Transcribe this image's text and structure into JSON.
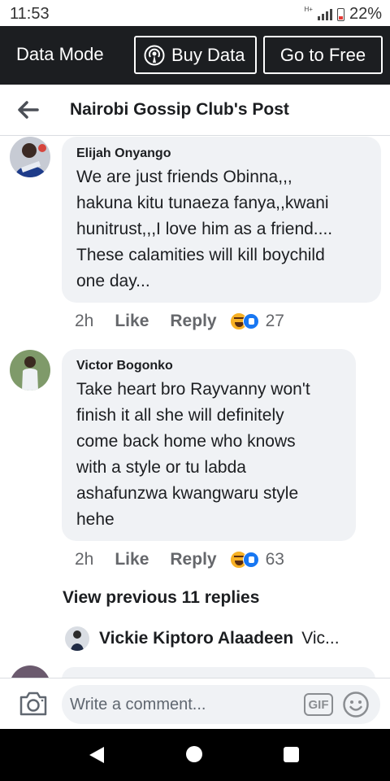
{
  "status_bar": {
    "time": "11:53",
    "network": "H+",
    "battery": "22%"
  },
  "data_banner": {
    "mode_label": "Data Mode",
    "buy_label": "Buy Data",
    "free_label": "Go to Free"
  },
  "header": {
    "title": "Nairobi Gossip Club's Post"
  },
  "comments": [
    {
      "author": "Elijah Onyango",
      "text": "We are just friends Obinna,,,\nhakuna kitu tunaeza fanya,,kwani\nhunitrust,,,I love him as a friend....\nThese calamities will kill boychild\none day...",
      "time": "2h",
      "like": "Like",
      "reply": "Reply",
      "reactions": "27"
    },
    {
      "author": "Victor Bogonko",
      "text": "Take heart bro Rayvanny won't\nfinish it all she will definitely\ncome back home who knows\nwith a style or tu labda\nashafunzwa kwangwaru style\nhehe",
      "time": "2h",
      "like": "Like",
      "reply": "Reply",
      "reactions": "63"
    }
  ],
  "view_previous": "View previous 11 replies",
  "reply_preview": {
    "name": "Vickie Kiptoro Alaadeen",
    "snippet": "Vic..."
  },
  "composer": {
    "placeholder": "Write a comment...",
    "gif_label": "GIF"
  },
  "icons": {
    "back": "arrow-left-icon",
    "buy": "broadcast-icon",
    "camera": "camera-icon",
    "emoji": "smiley-icon",
    "nav_back": "triangle-back-icon",
    "nav_home": "circle-home-icon",
    "nav_recent": "square-recent-icon"
  },
  "colors": {
    "banner": "#1c1e21",
    "bubble": "#f0f2f5",
    "like_blue": "#1877f2",
    "haha_yellow": "#f7b125"
  }
}
